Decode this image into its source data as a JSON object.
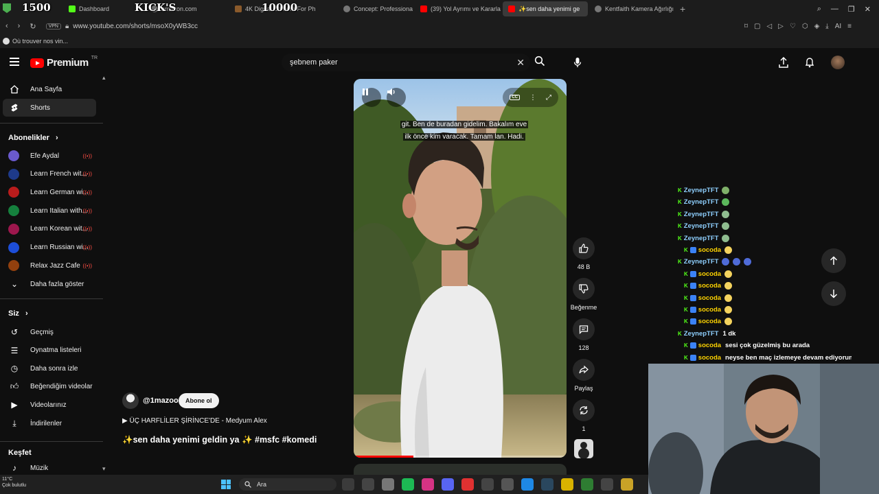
{
  "browser": {
    "overlay": {
      "counter_left": "1500",
      "title_mid": "KICK'S",
      "counter_right": "10000"
    },
    "tabs": [
      {
        "label": "Dashboard",
        "favicon": "green"
      },
      {
        "label": "amazon.com",
        "favicon": "gray"
      },
      {
        "label": "4K Digital Camera For Ph",
        "favicon": "brown"
      },
      {
        "label": "Concept: Professiona",
        "favicon": "gray"
      },
      {
        "label": "(39) Yol Ayrımı ve Kararla",
        "favicon": "red"
      },
      {
        "label": "✨sen daha yenimi ge",
        "favicon": "red",
        "active": true
      },
      {
        "label": "Kentfaith Kamera Ağırlığı",
        "favicon": "gray"
      }
    ],
    "url": "www.youtube.com/shorts/msoX0yWB3cc",
    "vpn_label": "VPN",
    "bookmark_label": "Où trouver nos vin...",
    "ext_ai_label": "AI"
  },
  "yt_header": {
    "logo_text": "Premium",
    "logo_region": "TR",
    "search_value": "şebnem paker"
  },
  "sidebar": {
    "main": [
      {
        "label": "Ana Sayfa",
        "icon": "home-icon"
      },
      {
        "label": "Shorts",
        "icon": "shorts-icon",
        "active": true
      }
    ],
    "subs_title": "Abonelikler",
    "subs": [
      {
        "label": "Efe Aydal",
        "color": "#6a5acd"
      },
      {
        "label": "Learn French wit...",
        "color": "#1e3a8a"
      },
      {
        "label": "Learn German wi...",
        "color": "#b91c1c"
      },
      {
        "label": "Learn Italian with...",
        "color": "#15803d"
      },
      {
        "label": "Learn Korean wit...",
        "color": "#9d174d"
      },
      {
        "label": "Learn Russian wi...",
        "color": "#1d4ed8"
      },
      {
        "label": "Relax Jazz Cafe",
        "color": "#92400e"
      }
    ],
    "show_more": "Daha fazla göster",
    "you_title": "Siz",
    "you": [
      {
        "label": "Geçmiş",
        "icon": "history-icon"
      },
      {
        "label": "Oynatma listeleri",
        "icon": "playlist-icon"
      },
      {
        "label": "Daha sonra izle",
        "icon": "clock-icon"
      },
      {
        "label": "Beğendiğim videolar",
        "icon": "like-icon"
      },
      {
        "label": "Videolarınız",
        "icon": "video-icon"
      },
      {
        "label": "İndirilenler",
        "icon": "download-icon"
      }
    ],
    "explore_title": "Keşfet",
    "explore": [
      {
        "label": "Müzik",
        "icon": "music-icon"
      }
    ]
  },
  "short": {
    "caption_line1": "git. Ben de buradan gidelim. Bakalım eve",
    "caption_line2": "ilk önce kim varacak. Tamam lan. Hadi.",
    "progress": 0.28,
    "channel": "@1mazoo",
    "subscribe_label": "Abone ol",
    "song": "ÜÇ HARFLİLER ŞİRİNCE'DE - Medyum Alex",
    "title": "✨sen daha yenimi geldin ya ✨ #msfc #komedi"
  },
  "actions": {
    "likes": "48 B",
    "dislike_label": "Beğenme",
    "comments": "128",
    "share_label": "Paylaş",
    "remix_count": "1"
  },
  "chat": [
    {
      "user": "ZeynepTFT",
      "msg": "",
      "type": "z",
      "emotes": [
        "#7fb069"
      ]
    },
    {
      "user": "ZeynepTFT",
      "msg": "",
      "type": "z",
      "emotes": [
        "#5cb85c"
      ]
    },
    {
      "user": "ZeynepTFT",
      "msg": "",
      "type": "z",
      "emotes": [
        "#8fbc8f"
      ]
    },
    {
      "user": "ZeynepTFT",
      "msg": "",
      "type": "z",
      "emotes": [
        "#8fbc8f"
      ]
    },
    {
      "user": "ZeynepTFT",
      "msg": "",
      "type": "z",
      "emotes": [
        "#8fbc8f"
      ]
    },
    {
      "user": "socoda",
      "msg": "",
      "type": "s",
      "emotes": [
        "#f4d35e"
      ]
    },
    {
      "user": "ZeynepTFT",
      "msg": "",
      "type": "z",
      "emotes": [
        "#4f6bd8",
        "#4f6bd8",
        "#4f6bd8"
      ]
    },
    {
      "user": "socoda",
      "msg": "",
      "type": "s",
      "emotes": [
        "#f4d35e"
      ]
    },
    {
      "user": "socoda",
      "msg": "",
      "type": "s",
      "emotes": [
        "#f4d35e"
      ]
    },
    {
      "user": "socoda",
      "msg": "",
      "type": "s",
      "emotes": [
        "#f4d35e"
      ]
    },
    {
      "user": "socoda",
      "msg": "",
      "type": "s",
      "emotes": [
        "#f4d35e"
      ]
    },
    {
      "user": "socoda",
      "msg": "",
      "type": "s",
      "emotes": [
        "#f4d35e"
      ]
    },
    {
      "user": "ZeynepTFT",
      "msg": "1 dk",
      "type": "z",
      "emotes": []
    },
    {
      "user": "socoda",
      "msg": "sesi çok güzelmiş bu arada",
      "type": "s",
      "emotes": []
    },
    {
      "user": "socoda",
      "msg": "neyse ben maç izlemeye devam ediyorum",
      "type": "s",
      "emotes": []
    }
  ],
  "taskbar": {
    "weather_temp": "11°C",
    "weather_desc": "Çok bulutlu",
    "search_label": "Ara",
    "apps": [
      "#3b3b3b",
      "#444",
      "#777",
      "#1db954",
      "#d63384",
      "#5865f2",
      "#e03131",
      "#444",
      "#555",
      "#1e88e5",
      "#2a475e",
      "#d9b300",
      "#2e7d32",
      "#444",
      "#c9a227"
    ]
  }
}
